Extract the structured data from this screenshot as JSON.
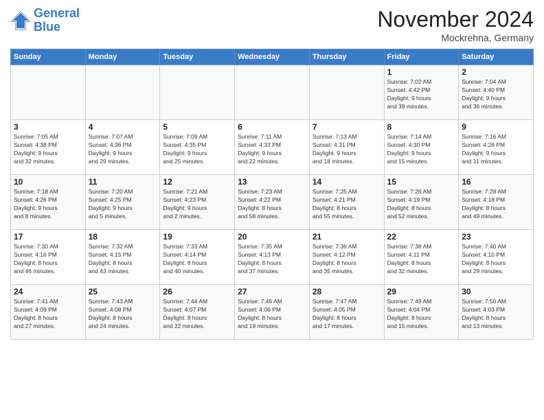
{
  "header": {
    "logo_line1": "General",
    "logo_line2": "Blue",
    "month_title": "November 2024",
    "subtitle": "Mockrehna, Germany"
  },
  "weekdays": [
    "Sunday",
    "Monday",
    "Tuesday",
    "Wednesday",
    "Thursday",
    "Friday",
    "Saturday"
  ],
  "weeks": [
    [
      {
        "day": "",
        "info": ""
      },
      {
        "day": "",
        "info": ""
      },
      {
        "day": "",
        "info": ""
      },
      {
        "day": "",
        "info": ""
      },
      {
        "day": "",
        "info": ""
      },
      {
        "day": "1",
        "info": "Sunrise: 7:02 AM\nSunset: 4:42 PM\nDaylight: 9 hours\nand 39 minutes."
      },
      {
        "day": "2",
        "info": "Sunrise: 7:04 AM\nSunset: 4:40 PM\nDaylight: 9 hours\nand 36 minutes."
      }
    ],
    [
      {
        "day": "3",
        "info": "Sunrise: 7:05 AM\nSunset: 4:38 PM\nDaylight: 9 hours\nand 32 minutes."
      },
      {
        "day": "4",
        "info": "Sunrise: 7:07 AM\nSunset: 4:36 PM\nDaylight: 9 hours\nand 29 minutes."
      },
      {
        "day": "5",
        "info": "Sunrise: 7:09 AM\nSunset: 4:35 PM\nDaylight: 9 hours\nand 25 minutes."
      },
      {
        "day": "6",
        "info": "Sunrise: 7:11 AM\nSunset: 4:33 PM\nDaylight: 9 hours\nand 22 minutes."
      },
      {
        "day": "7",
        "info": "Sunrise: 7:13 AM\nSunset: 4:31 PM\nDaylight: 9 hours\nand 18 minutes."
      },
      {
        "day": "8",
        "info": "Sunrise: 7:14 AM\nSunset: 4:30 PM\nDaylight: 9 hours\nand 15 minutes."
      },
      {
        "day": "9",
        "info": "Sunrise: 7:16 AM\nSunset: 4:28 PM\nDaylight: 9 hours\nand 11 minutes."
      }
    ],
    [
      {
        "day": "10",
        "info": "Sunrise: 7:18 AM\nSunset: 4:26 PM\nDaylight: 9 hours\nand 8 minutes."
      },
      {
        "day": "11",
        "info": "Sunrise: 7:20 AM\nSunset: 4:25 PM\nDaylight: 9 hours\nand 5 minutes."
      },
      {
        "day": "12",
        "info": "Sunrise: 7:21 AM\nSunset: 4:23 PM\nDaylight: 9 hours\nand 2 minutes."
      },
      {
        "day": "13",
        "info": "Sunrise: 7:23 AM\nSunset: 4:22 PM\nDaylight: 8 hours\nand 58 minutes."
      },
      {
        "day": "14",
        "info": "Sunrise: 7:25 AM\nSunset: 4:21 PM\nDaylight: 8 hours\nand 55 minutes."
      },
      {
        "day": "15",
        "info": "Sunrise: 7:26 AM\nSunset: 4:19 PM\nDaylight: 8 hours\nand 52 minutes."
      },
      {
        "day": "16",
        "info": "Sunrise: 7:28 AM\nSunset: 4:18 PM\nDaylight: 8 hours\nand 49 minutes."
      }
    ],
    [
      {
        "day": "17",
        "info": "Sunrise: 7:30 AM\nSunset: 4:16 PM\nDaylight: 8 hours\nand 46 minutes."
      },
      {
        "day": "18",
        "info": "Sunrise: 7:32 AM\nSunset: 4:15 PM\nDaylight: 8 hours\nand 43 minutes."
      },
      {
        "day": "19",
        "info": "Sunrise: 7:33 AM\nSunset: 4:14 PM\nDaylight: 8 hours\nand 40 minutes."
      },
      {
        "day": "20",
        "info": "Sunrise: 7:35 AM\nSunset: 4:13 PM\nDaylight: 8 hours\nand 37 minutes."
      },
      {
        "day": "21",
        "info": "Sunrise: 7:36 AM\nSunset: 4:12 PM\nDaylight: 8 hours\nand 35 minutes."
      },
      {
        "day": "22",
        "info": "Sunrise: 7:38 AM\nSunset: 4:11 PM\nDaylight: 8 hours\nand 32 minutes."
      },
      {
        "day": "23",
        "info": "Sunrise: 7:40 AM\nSunset: 4:10 PM\nDaylight: 8 hours\nand 29 minutes."
      }
    ],
    [
      {
        "day": "24",
        "info": "Sunrise: 7:41 AM\nSunset: 4:09 PM\nDaylight: 8 hours\nand 27 minutes."
      },
      {
        "day": "25",
        "info": "Sunrise: 7:43 AM\nSunset: 4:08 PM\nDaylight: 8 hours\nand 24 minutes."
      },
      {
        "day": "26",
        "info": "Sunrise: 7:44 AM\nSunset: 4:07 PM\nDaylight: 8 hours\nand 22 minutes."
      },
      {
        "day": "27",
        "info": "Sunrise: 7:46 AM\nSunset: 4:06 PM\nDaylight: 8 hours\nand 19 minutes."
      },
      {
        "day": "28",
        "info": "Sunrise: 7:47 AM\nSunset: 4:05 PM\nDaylight: 8 hours\nand 17 minutes."
      },
      {
        "day": "29",
        "info": "Sunrise: 7:49 AM\nSunset: 4:04 PM\nDaylight: 8 hours\nand 15 minutes."
      },
      {
        "day": "30",
        "info": "Sunrise: 7:50 AM\nSunset: 4:03 PM\nDaylight: 8 hours\nand 13 minutes."
      }
    ]
  ]
}
